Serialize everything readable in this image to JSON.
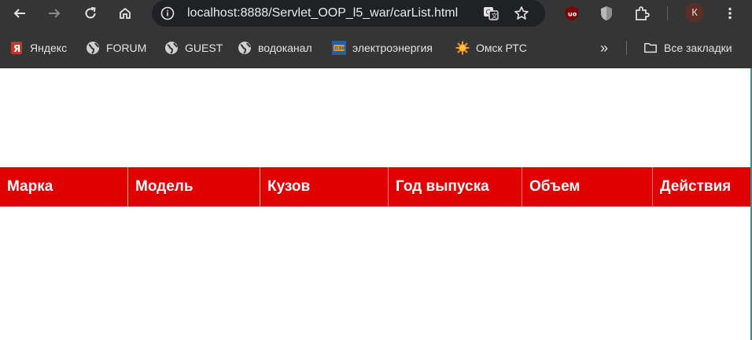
{
  "browser": {
    "url": "localhost:8888/Servlet_OOP_l5_war/carList.html",
    "profile_initial": "К",
    "icons": {
      "back": "arrow-left-icon",
      "forward": "arrow-right-icon",
      "reload": "reload-icon",
      "home": "home-icon",
      "site_info": "info-icon",
      "translate": "translate-icon",
      "bookmark_star": "star-icon",
      "ublock": "ublock-icon",
      "shield": "shield-icon",
      "extensions": "puzzle-icon",
      "menu": "kebab-menu-icon"
    }
  },
  "bookmarks": {
    "items": [
      {
        "label": "Яндекс",
        "icon": "yandex-icon"
      },
      {
        "label": "FORUM",
        "icon": "globe-icon"
      },
      {
        "label": "GUEST",
        "icon": "globe-icon"
      },
      {
        "label": "водоканал",
        "icon": "globe-icon"
      },
      {
        "label": "электроэнергия",
        "icon": "oek-icon"
      },
      {
        "label": "Омск РТС",
        "icon": "sun-icon"
      }
    ],
    "more_label": "»",
    "all_bookmarks_label": "Все закладки"
  },
  "table": {
    "header_color": "#e10000",
    "columns": [
      "Марка",
      "Модель",
      "Кузов",
      "Год выпуска",
      "Объем",
      "Действия"
    ]
  }
}
